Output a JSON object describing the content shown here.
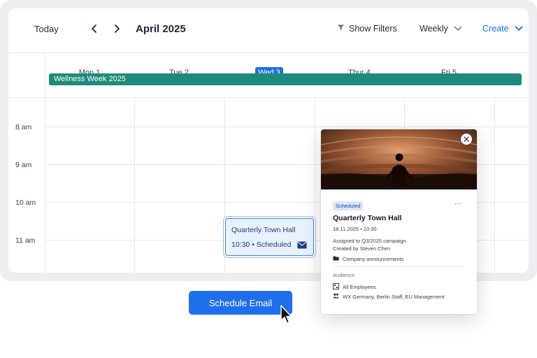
{
  "toolbar": {
    "today_label": "Today",
    "month_label": "April 2025",
    "filter_label": "Show Filters",
    "view_label": "Weekly",
    "create_label": "Create"
  },
  "days": [
    {
      "label": "Mon 1",
      "today": false
    },
    {
      "label": "Tue 2",
      "today": false
    },
    {
      "label": "Wed 3",
      "today": true
    },
    {
      "label": "Thur 4",
      "today": false
    },
    {
      "label": "Fri 5",
      "today": false
    }
  ],
  "allday_event": "Wellness Week 2025",
  "hours": [
    "8 am",
    "9 am",
    "10 am",
    "11 am"
  ],
  "event": {
    "title": "Quarterly Town Hall",
    "time": "10:30",
    "status": "Scheduled",
    "separator": "•"
  },
  "popup": {
    "badge": "Scheduled",
    "more": "···",
    "title": "Quarterly Town Hall",
    "datetime": "18.11.2025 • 10:30",
    "assigned_prefix": "Assigned to ",
    "assigned_campaign": "Q3/2025 campaign",
    "created_prefix": "Created by ",
    "created_by": "Steven Chen",
    "folder": "Company announcements",
    "audience_heading": "Audience",
    "audience_primary": "All Employees",
    "audience_secondary": "WX Germany, Berlin Staff, EU Management"
  },
  "schedule_button": "Schedule Email",
  "colors": {
    "accent": "#1d6fd6",
    "today_badge": "#1f6fdc",
    "allday_bar": "#1d8a7c",
    "event_border": "#3b82f6",
    "button": "#1f6fec"
  },
  "icons": {
    "prev": "chevron-left-icon",
    "next": "chevron-right-icon",
    "filter": "filter-icon",
    "view_caret": "chevron-down-icon",
    "create_caret": "chevron-down-icon",
    "event": "mail-icon",
    "close": "close-icon",
    "folder": "folder-icon",
    "audience_primary": "org-chart-icon",
    "audience_secondary": "people-icon",
    "pointer": "cursor-arrow-icon"
  }
}
